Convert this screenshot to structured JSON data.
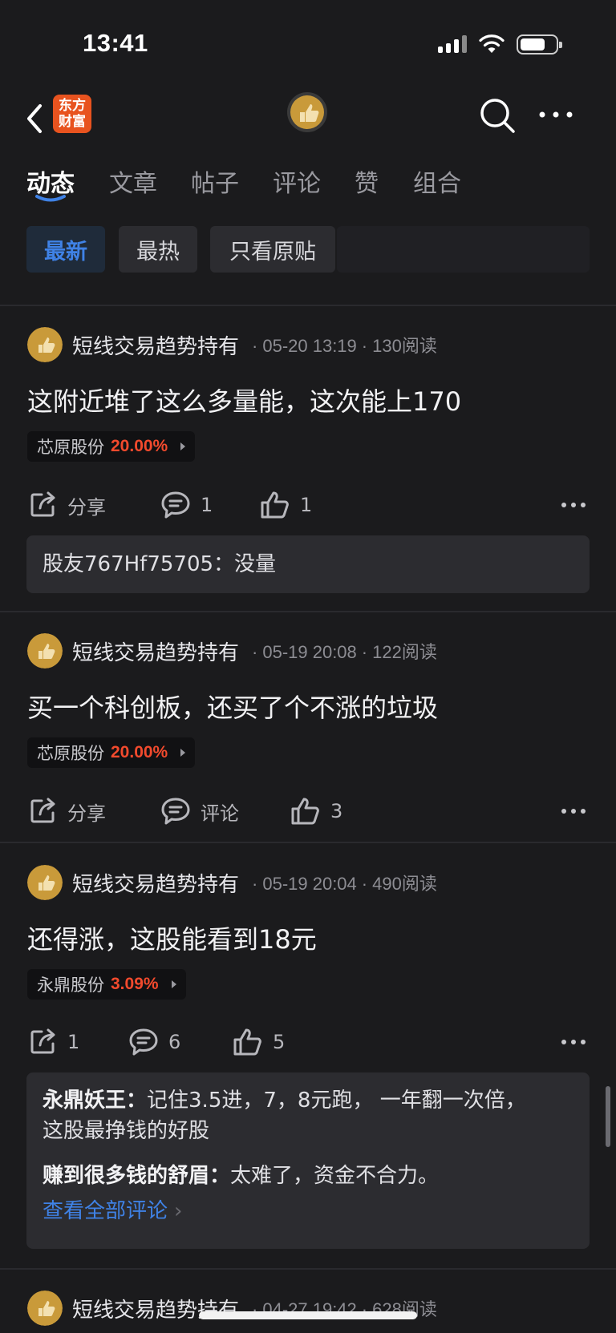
{
  "status": {
    "time": "13:41"
  },
  "nav": {
    "logo_text": "东方财富"
  },
  "tabs": [
    {
      "label": "动态",
      "active": true
    },
    {
      "label": "文章"
    },
    {
      "label": "帖子"
    },
    {
      "label": "评论"
    },
    {
      "label": "赞"
    },
    {
      "label": "组合"
    }
  ],
  "filters": [
    {
      "label": "最新",
      "active": true
    },
    {
      "label": "最热"
    },
    {
      "label": "只看原贴"
    }
  ],
  "posts": [
    {
      "author": "短线交易趋势持有",
      "date": "05-20 13:19",
      "reads": "130阅读",
      "body": "这附近堆了这么多量能，这次能上170",
      "stock": {
        "name": "芯原股份",
        "pct": "20.00%"
      },
      "share": "分享",
      "comments": "1",
      "likes": "1",
      "reply_comments": [
        {
          "name": "股友767Hf75705：",
          "text": "没量"
        }
      ]
    },
    {
      "author": "短线交易趋势持有",
      "date": "05-19 20:08",
      "reads": "122阅读",
      "body": "买一个科创板，还买了个不涨的垃圾",
      "stock": {
        "name": "芯原股份",
        "pct": "20.00%"
      },
      "share": "分享",
      "comments": "评论",
      "likes": "3"
    },
    {
      "author": "短线交易趋势持有",
      "date": "05-19 20:04",
      "reads": "490阅读",
      "body": "还得涨，这股能看到18元",
      "stock": {
        "name": "永鼎股份",
        "pct": "3.09%"
      },
      "share": "1",
      "comments": "6",
      "likes": "5",
      "reply_comments": [
        {
          "name": "永鼎妖王：",
          "text": "记住3.5进，7，8元跑， 一年翻一次倍，",
          "text2": "这股最挣钱的好股"
        },
        {
          "name": "赚到很多钱的舒眉：",
          "text": "太难了，资金不合力。"
        }
      ],
      "view_all": "查看全部评论"
    },
    {
      "author": "短线交易趋势持有",
      "date": "04-27 19:42",
      "reads": "628阅读"
    }
  ],
  "colors": {
    "background": "#1b1b1d",
    "accent_blue": "#3f82e6",
    "rise_red": "#f24a2d",
    "brand_orange": "#e8531f"
  }
}
